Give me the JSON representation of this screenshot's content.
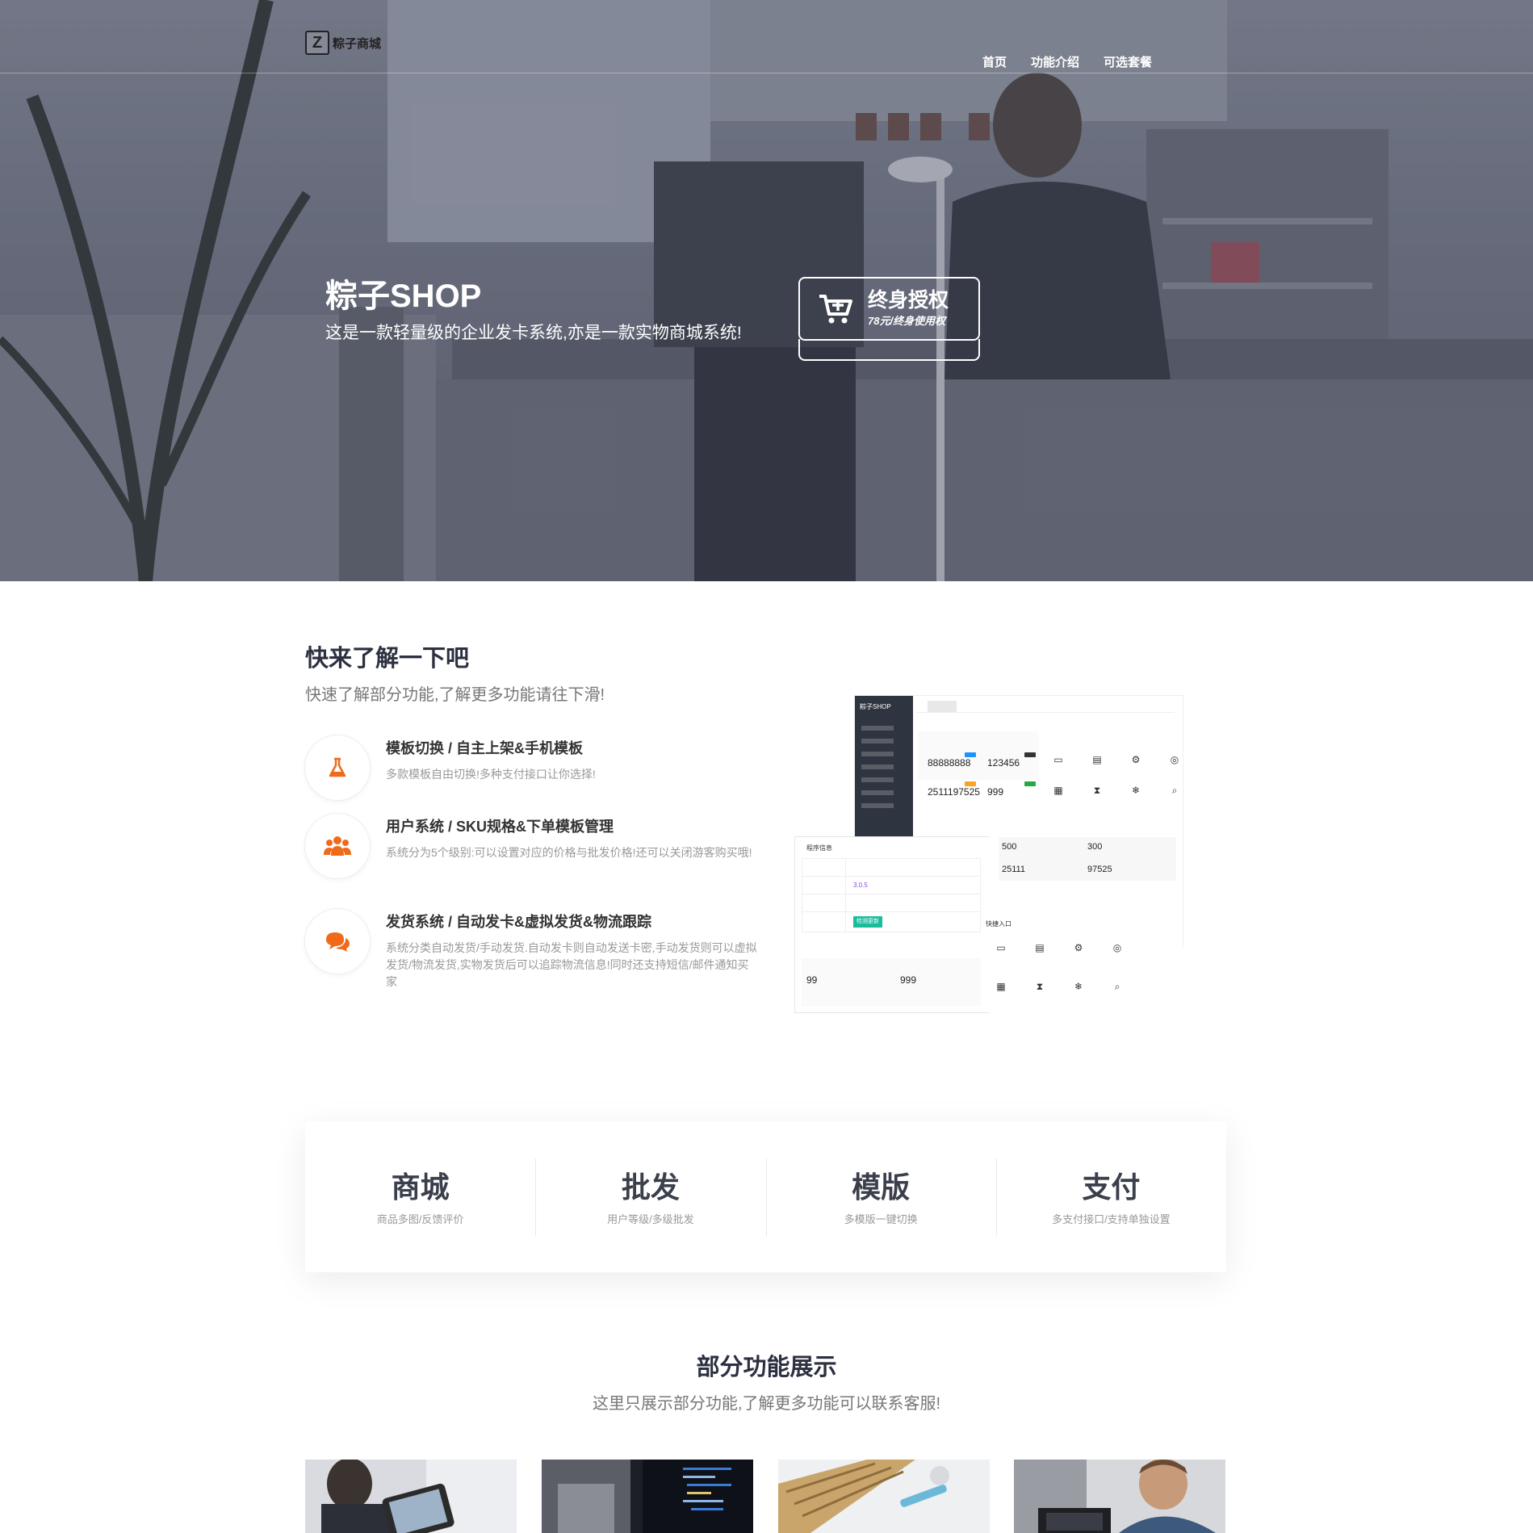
{
  "header": {
    "logo_letter": "Z",
    "logo_text": "粽子商城",
    "nav": [
      "首页",
      "功能介绍",
      "可选套餐"
    ]
  },
  "hero": {
    "title": "粽子SHOP",
    "subtitle": "这是一款轻量级的企业发卡系统,亦是一款实物商城系统!",
    "buy_title": "终身授权",
    "buy_price": "78元/终身使用权"
  },
  "about": {
    "title": "快来了解一下吧",
    "subtitle": "快速了解部分功能,了解更多功能请往下滑!",
    "features": [
      {
        "title": "模板切换 / 自主上架&手机模板",
        "desc": "多款模板自由切换!多种支付接口让你选择!",
        "icon": "flask-icon"
      },
      {
        "title": "用户系统 / SKU规格&下单模板管理",
        "desc": "系统分为5个级别:可以设置对应的价格与批发价格!还可以关闭游客购买哦!",
        "icon": "users-icon"
      },
      {
        "title": "发货系统 / 自动发卡&虚拟发货&物流跟踪",
        "desc": "系统分类自动发货/手动发货.自动发卡则自动发送卡密,手动发货则可以虚拟发货/物流发货,实物发货后可以追踪物流信息!同时还支持短信/邮件通知买家",
        "icon": "chat-icon"
      }
    ],
    "dashboard": {
      "brand": "粽子SHOP",
      "n1": "88888888",
      "n2": "123456",
      "n3": "2511197525",
      "n4": "999",
      "r1": "500",
      "r2": "300",
      "r3": "25111",
      "r4": "97525",
      "b1": "99",
      "b2": "999",
      "info_version": "3.0.5",
      "info_btn": "检测更新",
      "program_info": "程序信息",
      "quick_entry": "快捷入口"
    }
  },
  "stats": [
    {
      "title": "商城",
      "desc": "商品多图/反馈评价"
    },
    {
      "title": "批发",
      "desc": "用户等级/多级批发"
    },
    {
      "title": "模版",
      "desc": "多模版一键切换"
    },
    {
      "title": "支付",
      "desc": "多支付接口/支持单独设置"
    }
  ],
  "showcase": {
    "title": "部分功能展示",
    "subtitle": "这里只展示部分功能,了解更多功能可以联系客服!"
  },
  "colors": {
    "accent": "#f06a1a",
    "dark_text": "#2c3040",
    "sidebar": "#2f3540"
  }
}
